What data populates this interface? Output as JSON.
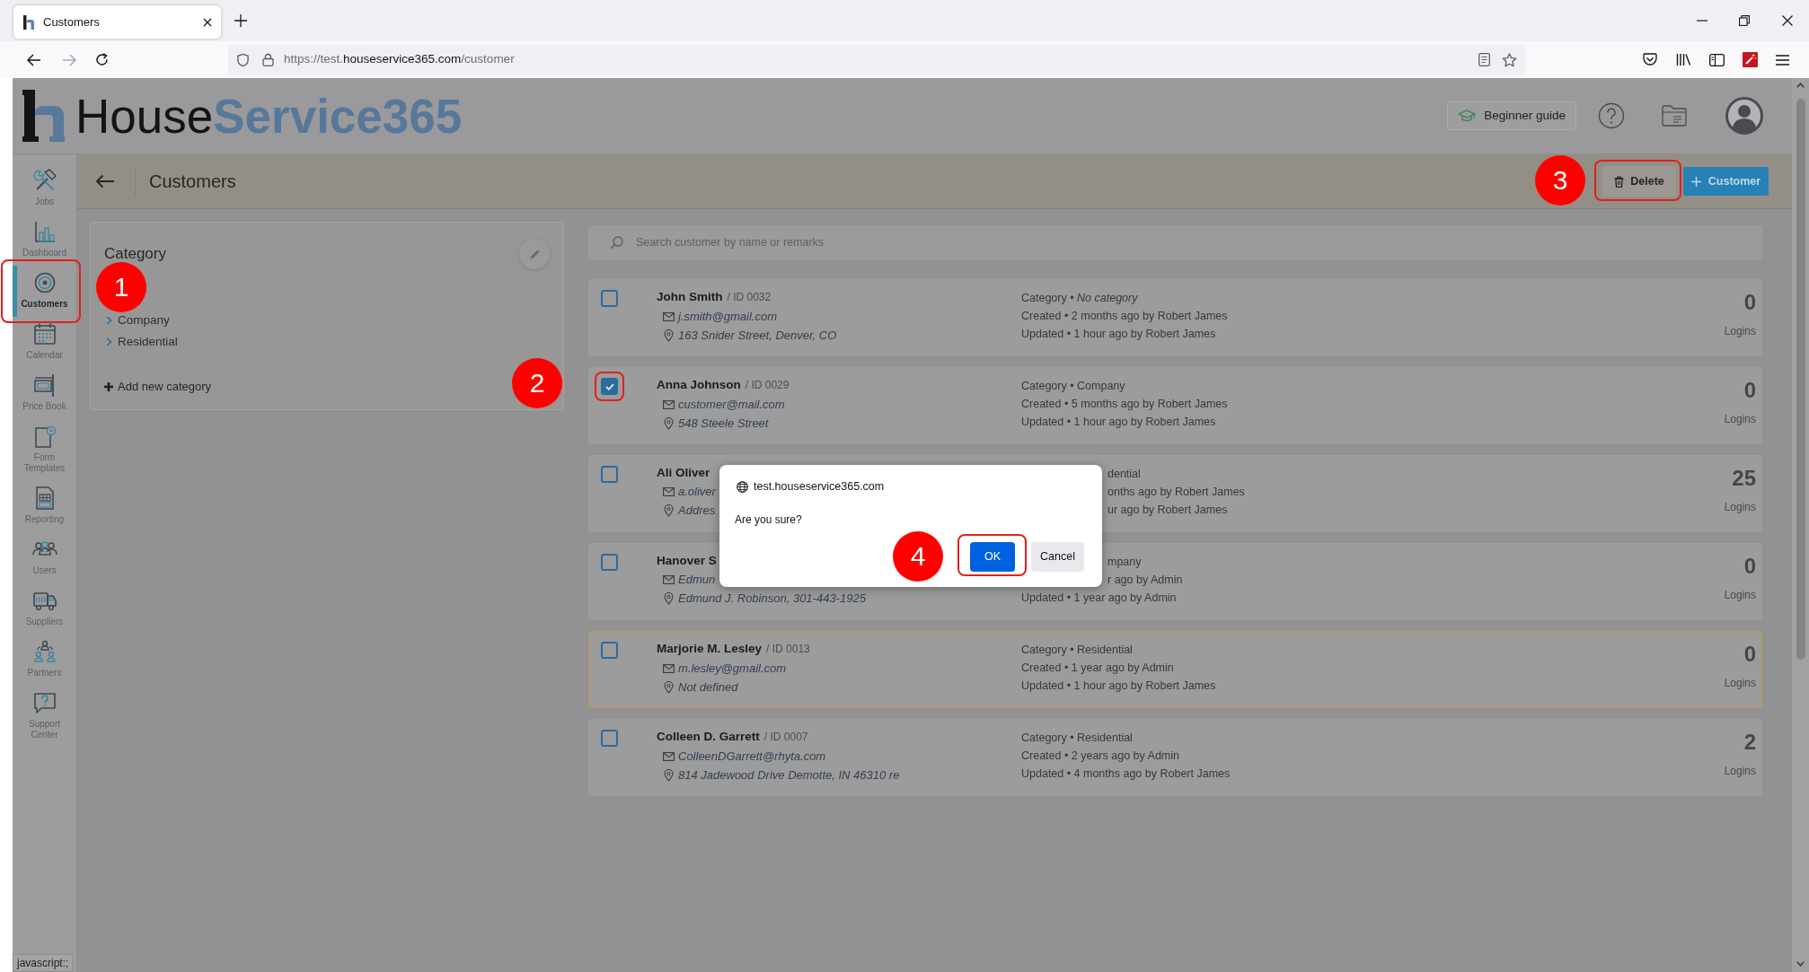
{
  "browser": {
    "tab": {
      "title": "Customers"
    },
    "url": {
      "scheme": "https://test.",
      "domain": "houseservice365.com",
      "path": "/customer"
    },
    "status_text": "javascript:;"
  },
  "header": {
    "logo": {
      "dark": "House",
      "accent": "Service365"
    },
    "guide_button": "Beginner guide"
  },
  "sidebar": {
    "items": [
      {
        "label": "Jobs",
        "selected": false
      },
      {
        "label": "Dashboard",
        "selected": false
      },
      {
        "label": "Customers",
        "selected": true,
        "callout": "1"
      },
      {
        "label": "Calendar",
        "selected": false
      },
      {
        "label": "Price Book",
        "selected": false
      },
      {
        "label": "Form Templates",
        "selected": false
      },
      {
        "label": "Reporting",
        "selected": false
      },
      {
        "label": "Users",
        "selected": false
      },
      {
        "label": "Suppliers",
        "selected": false
      },
      {
        "label": "Partners",
        "selected": false
      },
      {
        "label": "Support Center",
        "selected": false
      }
    ]
  },
  "page": {
    "title": "Customers",
    "delete_button": {
      "label": "Delete",
      "callout": "3"
    },
    "add_button": {
      "label": "Customer"
    }
  },
  "category_panel": {
    "title": "Category",
    "items": [
      "Company",
      "Residential"
    ],
    "add_label": "Add new category"
  },
  "search": {
    "placeholder": "Search customer by name or remarks"
  },
  "customers": [
    {
      "name": "John Smith",
      "id": "/ ID 0032",
      "email": "j.smith@gmail.com",
      "address": "163 Snider Street, Denver, CO",
      "meta": [
        "Category • *No category*",
        "Created • 2 months ago by Robert James",
        "Updated • 1 hour ago by Robert James"
      ],
      "logins": "0",
      "logins_label": "Logins",
      "checked": false,
      "highlighted": false
    },
    {
      "name": "Anna Johnson",
      "id": "/ ID 0029",
      "email": "customer@mail.com",
      "address": "548 Steele Street",
      "meta": [
        "Category • Company",
        "Created • 5 months ago by Robert James",
        "Updated • 1 hour ago by Robert James"
      ],
      "logins": "0",
      "logins_label": "Logins",
      "checked": true,
      "highlighted": false,
      "callout": "2"
    },
    {
      "name": "Ali Oliver",
      "email": "a.oliver",
      "address": "Addres",
      "meta": [
        "dential",
        "onths ago by Robert James",
        "ur ago by Robert James"
      ],
      "logins": "25",
      "logins_label": "Logins",
      "checked": false,
      "highlighted": false
    },
    {
      "name": "Hanover S",
      "email": "Edmun",
      "address": "Edmund J. Robinson, 301-443-1925",
      "meta": [
        "mpany",
        "r ago by Admin",
        "Updated • 1 year ago by Admin"
      ],
      "logins": "0",
      "logins_label": "Logins",
      "checked": false,
      "highlighted": false
    },
    {
      "name": "Marjorie M. Lesley",
      "id": "/ ID 0013",
      "email": "m.lesley@gmail.com",
      "address": "Not defined",
      "meta": [
        "Category • Residential",
        "Created • 1 year ago by Admin",
        "Updated • 1 hour ago by Robert James"
      ],
      "logins": "0",
      "logins_label": "Logins",
      "checked": false,
      "highlighted": true
    },
    {
      "name": "Colleen D. Garrett",
      "id": "/ ID 0007",
      "email": "ColleenDGarrett@rhyta.com",
      "address": "814 Jadewood Drive Demotte, IN 46310 re",
      "meta": [
        "Category • Residential",
        "Created • 2 years ago by Admin",
        "Updated • 4 months ago by Robert James"
      ],
      "logins": "2",
      "logins_label": "Logins",
      "checked": false,
      "highlighted": false
    }
  ],
  "dialog": {
    "origin": "test.houseservice365.com",
    "message": "Are you sure?",
    "ok_button": {
      "label": "OK",
      "callout": "4"
    },
    "cancel_button": {
      "label": "Cancel"
    }
  }
}
